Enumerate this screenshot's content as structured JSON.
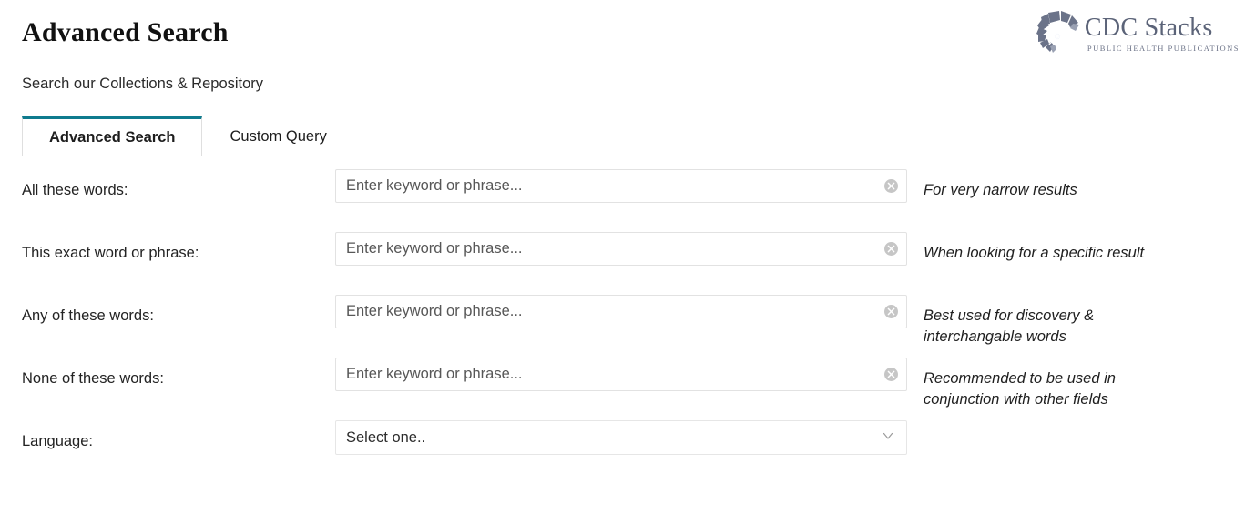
{
  "header": {
    "title": "Advanced Search",
    "subtitle": "Search our Collections & Repository"
  },
  "logo": {
    "name": "CDC Stacks",
    "tagline": "Public Health Publications",
    "mark_icon": "starburst-fan-icon",
    "color": "#5b6378"
  },
  "tabs": {
    "accent_color": "#0f7b8e",
    "items": [
      {
        "label": "Advanced Search",
        "active": true
      },
      {
        "label": "Custom Query",
        "active": false
      }
    ]
  },
  "form": {
    "rows": [
      {
        "label": "All these words:",
        "type": "text",
        "value": "",
        "placeholder": "Enter keyword or phrase...",
        "clear_icon": "clear-circle-icon",
        "hint": "For very narrow results"
      },
      {
        "label": "This exact word or phrase:",
        "type": "text",
        "value": "",
        "placeholder": "Enter keyword or phrase...",
        "clear_icon": "clear-circle-icon",
        "hint": "When looking for a specific result"
      },
      {
        "label": "Any of these words:",
        "type": "text",
        "value": "",
        "placeholder": "Enter keyword or phrase...",
        "clear_icon": "clear-circle-icon",
        "hint": "Best used for discovery & interchangable words"
      },
      {
        "label": "None of these words:",
        "type": "text",
        "value": "",
        "placeholder": "Enter keyword or phrase...",
        "clear_icon": "clear-circle-icon",
        "hint": "Recommended to be used in conjunction with other fields"
      },
      {
        "label": "Language:",
        "type": "select",
        "selected": "Select one..",
        "chevron_icon": "chevron-down-icon",
        "hint": ""
      }
    ]
  }
}
